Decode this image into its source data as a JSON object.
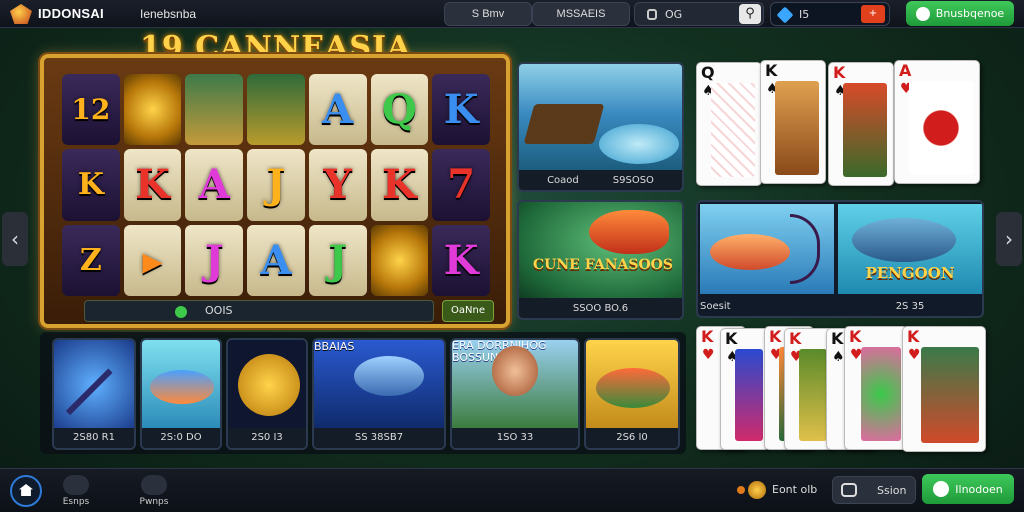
{
  "header": {
    "brand": "IDDONSAI",
    "subtitle": "Ienebsnba",
    "nav_1": "S Bmv",
    "nav_2": "MSSAEIS",
    "search_text": "OG",
    "wallet_balance": "I5",
    "cta_label": "Bnusbqenoe"
  },
  "slot": {
    "title": "19 CANNEASIA",
    "symbols": [
      "12",
      "",
      "",
      "",
      "",
      "",
      "K",
      "K",
      "A",
      "J",
      "Y",
      "K",
      "7",
      "Z",
      "",
      "J",
      "",
      "J",
      "",
      "K"
    ],
    "footer_text": "OOIS",
    "button_label": "OaNne"
  },
  "tiles": {
    "top_left_caption_1": "Coaod",
    "top_left_caption_2": "S9SOSO",
    "mid_left_title": "CUNE FANASOOS",
    "mid_left_caption": "SSOO BO.6",
    "fish_left_caption": "Soesit",
    "fish_right_title": "PENGOON",
    "fish_right_caption": "2S 35"
  },
  "bottom_games": [
    {
      "caption": "2S80 R1"
    },
    {
      "caption": "2S:0 DO"
    },
    {
      "caption": "2S0 I3"
    },
    {
      "caption": "SS 38SB7",
      "overlay": "BBAIAS"
    },
    {
      "caption": "1SO 33",
      "overlay": "ERA DORRNIHOG BOSSUN"
    },
    {
      "caption": "2S6 I0"
    }
  ],
  "cards_top": [
    "Q",
    "K",
    "K",
    "A"
  ],
  "cards_bottom": [
    "K",
    "K",
    "K",
    "K",
    "K",
    "K",
    "K"
  ],
  "bottomnav": {
    "item_1": "Esnps",
    "item_2": "Pwnps",
    "balance": "Eont olb",
    "chat": "Ssion",
    "cta": "Ilnodoen"
  }
}
